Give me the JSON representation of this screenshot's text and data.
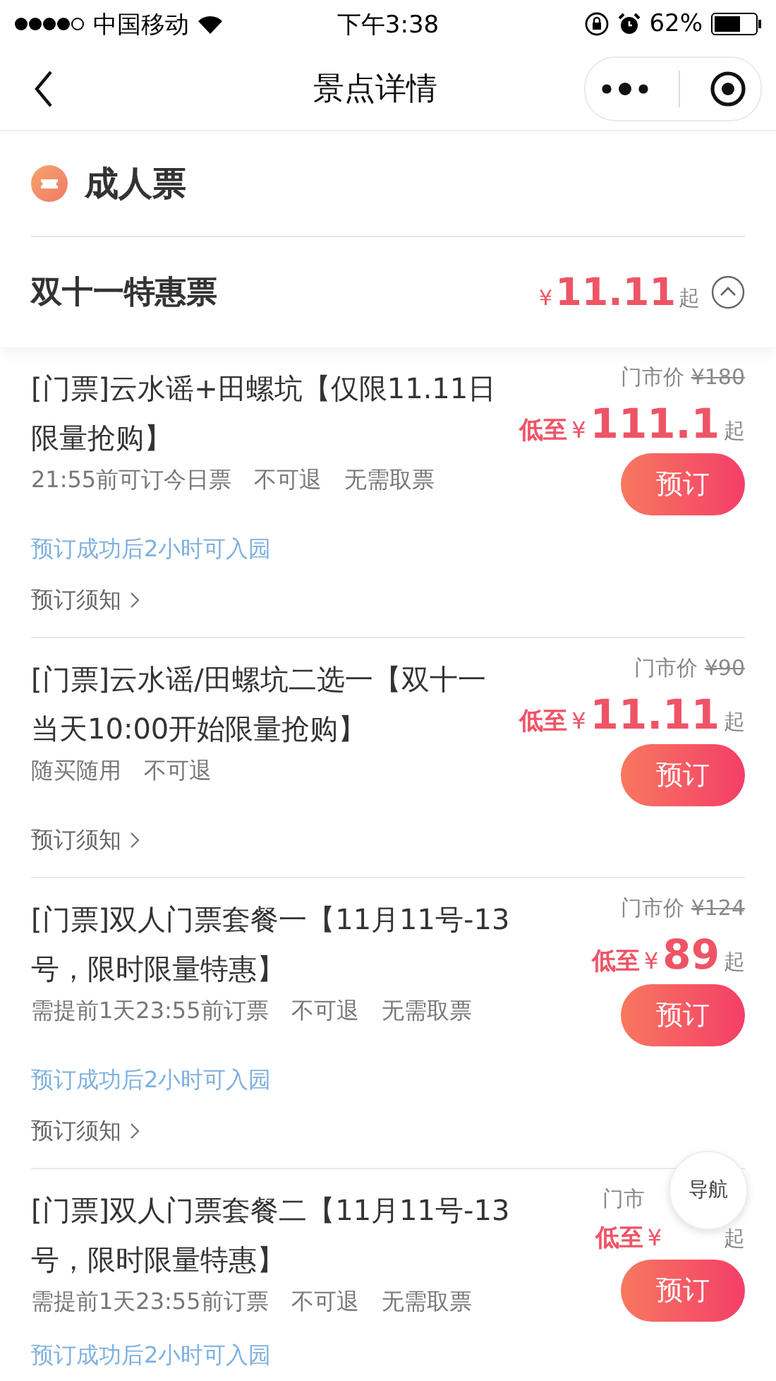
{
  "status_bar": {
    "carrier": "中国移动",
    "time": "下午3:38",
    "battery": "62%"
  },
  "nav": {
    "title": "景点详情"
  },
  "section": {
    "title": "成人票"
  },
  "group": {
    "title": "双十一特惠票",
    "currency": "¥",
    "price": "11.11",
    "suffix": "起",
    "expanded": true
  },
  "tickets": [
    {
      "title": "[门票]云水谣+田螺坑【仅限11.11日限量抢购】",
      "market_label": "门市价",
      "market_price": "¥180",
      "price_label": "低至",
      "currency": "¥",
      "price": "111.1",
      "suffix": "起",
      "button": "预订",
      "tags": [
        "21:55前可订今日票",
        "不可退",
        "无需取票"
      ],
      "notice": "预订成功后2小时可入园",
      "link": "预订须知"
    },
    {
      "title": "[门票]云水谣/田螺坑二选一【双十一当天10:00开始限量抢购】",
      "market_label": "门市价",
      "market_price": "¥90",
      "price_label": "低至",
      "currency": "¥",
      "price": "11.11",
      "suffix": "起",
      "button": "预订",
      "tags": [
        "随买随用",
        "不可退"
      ],
      "link": "预订须知"
    },
    {
      "title": "[门票]双人门票套餐一【11月11号-13号，限时限量特惠】",
      "market_label": "门市价",
      "market_price": "¥124",
      "price_label": "低至",
      "currency": "¥",
      "price": "89",
      "suffix": "起",
      "button": "预订",
      "tags": [
        "需提前1天23:55前订票",
        "不可退",
        "无需取票"
      ],
      "notice": "预订成功后2小时可入园",
      "link": "预订须知"
    },
    {
      "title": "[门票]双人门票套餐二【11月11号-13号，限时限量特惠】",
      "market_label": "门市",
      "price_label": "低至",
      "currency": "¥",
      "suffix": "起",
      "button": "预订",
      "tags": [
        "需提前1天23:55前订票",
        "不可退",
        "无需取票"
      ],
      "notice": "预订成功后2小时可入园"
    }
  ],
  "float_button": "导航"
}
